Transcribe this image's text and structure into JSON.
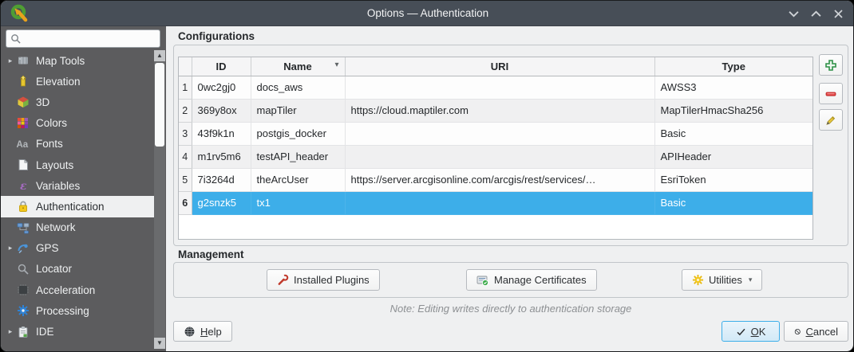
{
  "window": {
    "title": "Options — Authentication",
    "control_icons": [
      "window-shade-icon",
      "window-maximize-icon",
      "window-close-icon"
    ]
  },
  "search": {
    "value": "",
    "placeholder": ""
  },
  "sidebar": {
    "items": [
      {
        "label": "Map Tools",
        "icon": "map-tools-icon",
        "expandable": true,
        "selected": false
      },
      {
        "label": "Elevation",
        "icon": "elevation-icon",
        "expandable": false,
        "selected": false
      },
      {
        "label": "3D",
        "icon": "3d-icon",
        "expandable": false,
        "selected": false
      },
      {
        "label": "Colors",
        "icon": "colors-icon",
        "expandable": false,
        "selected": false
      },
      {
        "label": "Fonts",
        "icon": "fonts-icon",
        "expandable": false,
        "selected": false
      },
      {
        "label": "Layouts",
        "icon": "layouts-icon",
        "expandable": false,
        "selected": false
      },
      {
        "label": "Variables",
        "icon": "variables-icon",
        "expandable": false,
        "selected": false
      },
      {
        "label": "Authentication",
        "icon": "lock-icon",
        "expandable": false,
        "selected": true
      },
      {
        "label": "Network",
        "icon": "network-icon",
        "expandable": false,
        "selected": false
      },
      {
        "label": "GPS",
        "icon": "gps-icon",
        "expandable": true,
        "selected": false
      },
      {
        "label": "Locator",
        "icon": "locator-icon",
        "expandable": false,
        "selected": false
      },
      {
        "label": "Acceleration",
        "icon": "acceleration-icon",
        "expandable": false,
        "selected": false
      },
      {
        "label": "Processing",
        "icon": "processing-icon",
        "expandable": false,
        "selected": false
      },
      {
        "label": "IDE",
        "icon": "ide-icon",
        "expandable": true,
        "selected": false
      }
    ]
  },
  "configurations": {
    "title": "Configurations",
    "table": {
      "columns": [
        "ID",
        "Name",
        "URI",
        "Type"
      ],
      "sort_column": "Name",
      "sort_indicator": "▾",
      "rows": [
        {
          "num": "1",
          "id": "0wc2gj0",
          "name": "docs_aws",
          "uri": "",
          "type": "AWSS3",
          "selected": false
        },
        {
          "num": "2",
          "id": "369y8ox",
          "name": "mapTiler",
          "uri": "https://cloud.maptiler.com",
          "type": "MapTilerHmacSha256",
          "selected": false
        },
        {
          "num": "3",
          "id": "43f9k1n",
          "name": "postgis_docker",
          "uri": "",
          "type": "Basic",
          "selected": false
        },
        {
          "num": "4",
          "id": "m1rv5m6",
          "name": "testAPI_header",
          "uri": "",
          "type": "APIHeader",
          "selected": false
        },
        {
          "num": "5",
          "id": "7i3264d",
          "name": "theArcUser",
          "uri": "https://server.arcgisonline.com/arcgis/rest/services/…",
          "type": "EsriToken",
          "selected": false
        },
        {
          "num": "6",
          "id": "g2snzk5",
          "name": "tx1",
          "uri": "",
          "type": "Basic",
          "selected": true
        }
      ]
    },
    "row_actions": [
      "add-configuration",
      "remove-configuration",
      "edit-configuration"
    ]
  },
  "management": {
    "title": "Management",
    "buttons": [
      {
        "label": "Installed Plugins",
        "icon": "wrench-icon"
      },
      {
        "label": "Manage Certificates",
        "icon": "certificate-icon"
      },
      {
        "label": "Utilities",
        "icon": "gear-icon",
        "has_dropdown": true
      }
    ]
  },
  "note": "Note: Editing writes directly to authentication storage",
  "footer": {
    "help_key": "H",
    "help_rest": "elp",
    "ok_key": "O",
    "ok_rest": "K",
    "cancel_key": "C",
    "cancel_rest": "ancel"
  },
  "colors": {
    "accent": "#3daee9",
    "titlebar": "#474e57",
    "sidebar": "#5c5c5e",
    "panel": "#eff0f1",
    "selection_text": "#ffffff"
  }
}
